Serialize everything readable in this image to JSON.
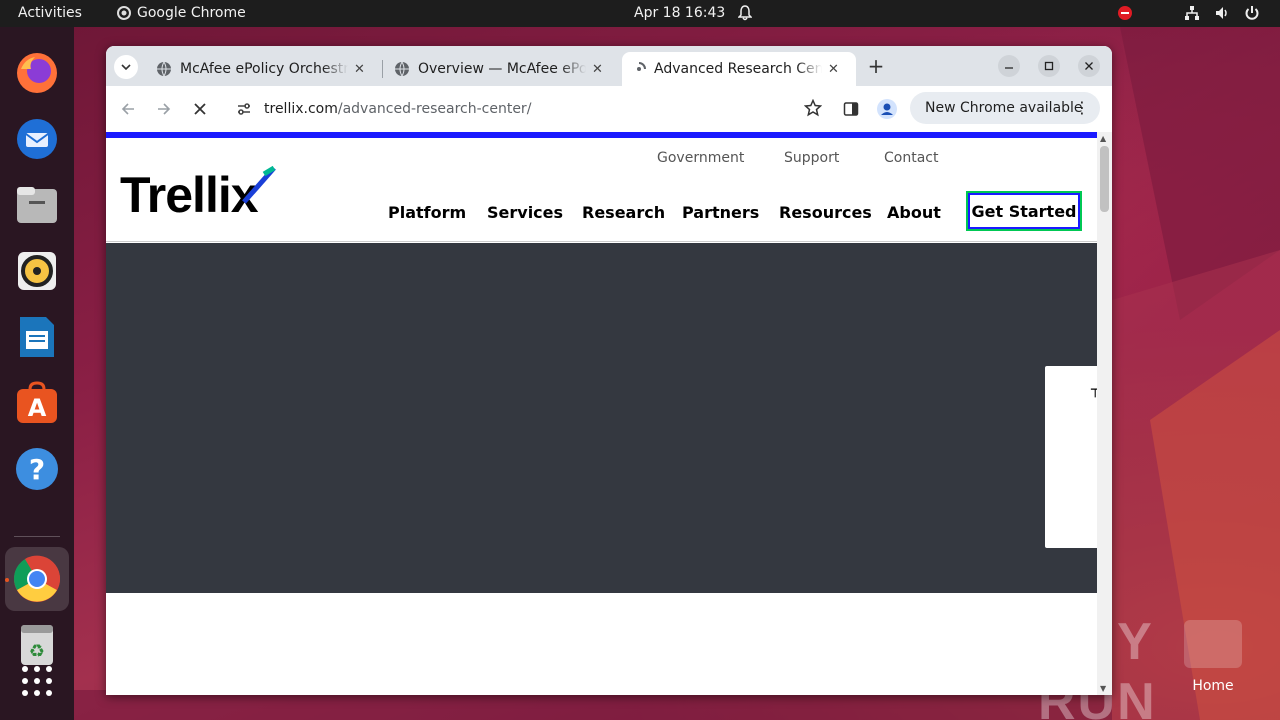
{
  "topbar": {
    "activities": "Activities",
    "app_name": "Google Chrome",
    "clock": "Apr 18  16:43"
  },
  "dock": {
    "items": [
      "firefox-icon",
      "thunderbird-icon",
      "files-icon",
      "rhythmbox-icon",
      "libreoffice-writer-icon",
      "app-center-icon",
      "help-icon",
      "chrome-icon",
      "trash-icon",
      "show-apps-icon"
    ]
  },
  "desktop": {
    "home_label": "Home",
    "watermark": "ANY RUN"
  },
  "browser": {
    "tabs": [
      {
        "title": "McAfee ePolicy Orchestrat",
        "active": false
      },
      {
        "title": "Overview — McAfee ePolic",
        "active": false
      },
      {
        "title": "Advanced Research Cente",
        "active": true
      }
    ],
    "new_tab": "+",
    "url_domain": "trellix.com",
    "url_path": "/advanced-research-center/",
    "update_chip": "New Chrome available"
  },
  "site": {
    "logo": "Trellix",
    "utility_nav": [
      "Government",
      "Support",
      "Contact"
    ],
    "main_nav": [
      "Platform",
      "Services",
      "Research",
      "Partners",
      "Resources",
      "About"
    ],
    "cta": "Get Started",
    "accent_color": "#1a1aff",
    "cta_border_color": "#00c853",
    "hero_color": "#343840"
  }
}
